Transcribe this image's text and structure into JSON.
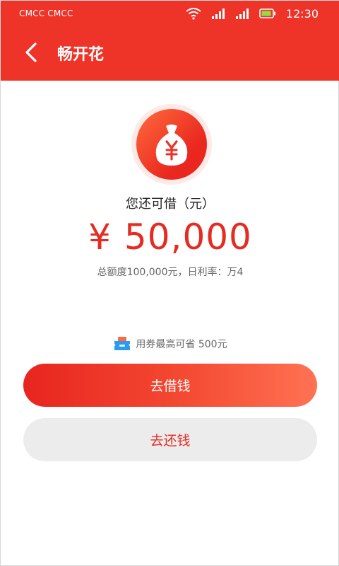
{
  "status_bar": {
    "carrier": "CMCC CMCC",
    "time": "12:30"
  },
  "header": {
    "title": "畅开花"
  },
  "main": {
    "available_label": "您还可借（元）",
    "currency_symbol": "¥",
    "amount": "50,000",
    "quota_info": "总额度100,000元，日利率：万4",
    "coupon_text": "用券最高可省 500元",
    "borrow_label": "去借钱",
    "repay_label": "去还钱"
  },
  "colors": {
    "brand_red": "#ee3329",
    "amount_red": "#e52c22",
    "coupon_blue": "#2b9af3"
  }
}
